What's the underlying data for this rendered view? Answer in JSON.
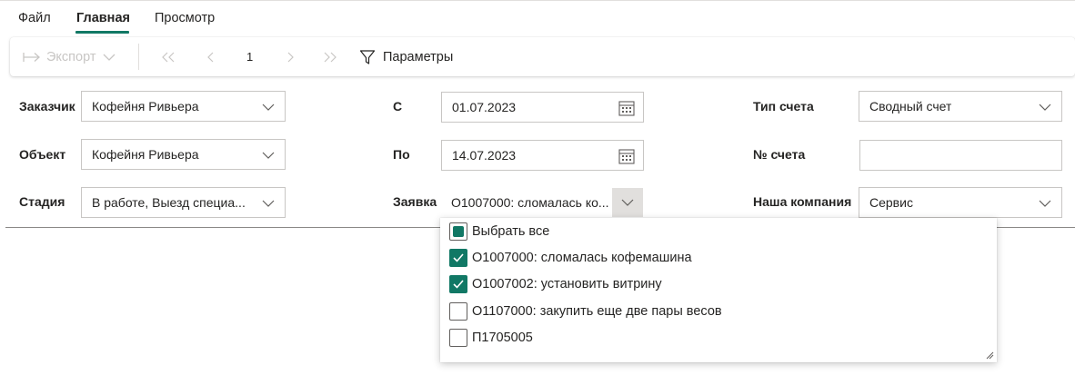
{
  "menu": {
    "tabs": [
      {
        "label": "Файл",
        "active": false
      },
      {
        "label": "Главная",
        "active": true
      },
      {
        "label": "Просмотр",
        "active": false
      }
    ]
  },
  "toolbar": {
    "export_label": "Экспорт",
    "page_number": "1",
    "params_label": "Параметры"
  },
  "filters": {
    "customer": {
      "label": "Заказчик",
      "value": "Кофейня Ривьера"
    },
    "object": {
      "label": "Объект",
      "value": "Кофейня Ривьера"
    },
    "stage": {
      "label": "Стадия",
      "value": "В работе, Выезд специа..."
    },
    "date_from": {
      "label": "С",
      "value": "01.07.2023"
    },
    "date_to": {
      "label": "По",
      "value": "14.07.2023"
    },
    "request": {
      "label": "Заявка",
      "value": "О1007000: сломалась ко..."
    },
    "invoice_type": {
      "label": "Тип счета",
      "value": "Сводный счет"
    },
    "invoice_number": {
      "label": "№ счета",
      "value": ""
    },
    "our_company": {
      "label": "Наша компания",
      "value": "Сервис"
    }
  },
  "request_dropdown": {
    "select_all": {
      "label": "Выбрать все",
      "state": "partial"
    },
    "options": [
      {
        "label": "О1007000: сломалась кофемашина",
        "checked": true
      },
      {
        "label": "О1007002: установить витрину",
        "checked": true
      },
      {
        "label": "О1107000: закупить еще две пары весов",
        "checked": false
      },
      {
        "label": "П1705005",
        "checked": false
      }
    ]
  },
  "colors": {
    "accent": "#117865",
    "border": "#c8c6c4",
    "text": "#252423",
    "disabled": "#c8c6c4"
  }
}
